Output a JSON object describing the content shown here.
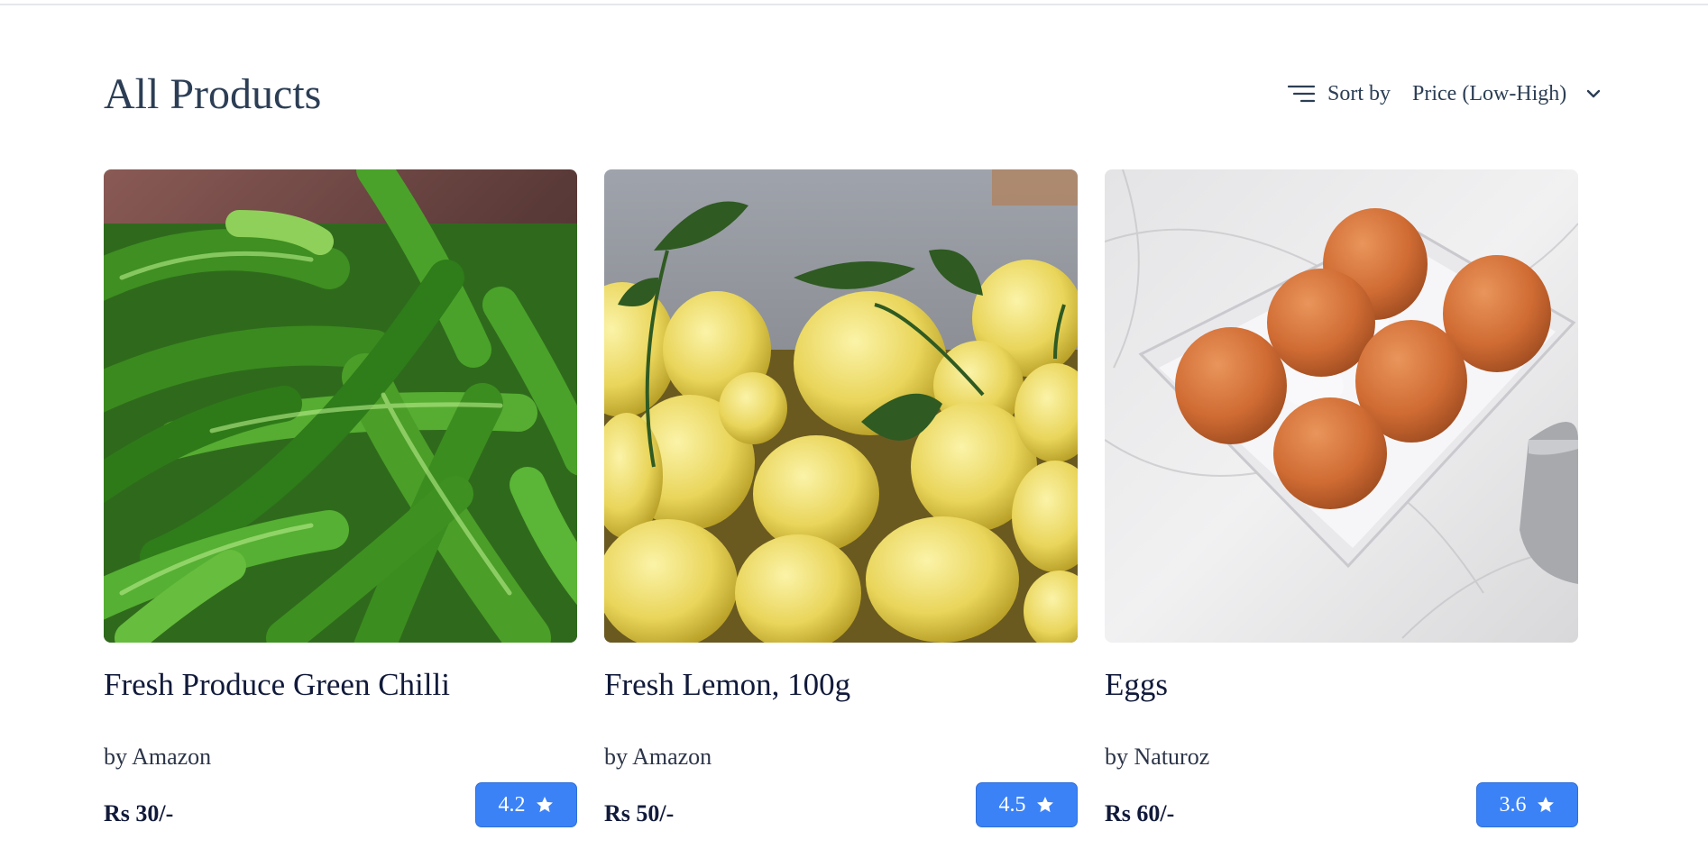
{
  "page": {
    "title": "All Products"
  },
  "sort": {
    "label": "Sort by",
    "value": "Price (Low-High)",
    "icon": "sort-lines-icon"
  },
  "products": [
    {
      "name": "Fresh Produce Green Chilli",
      "brand": "by Amazon",
      "price": "Rs 30/-",
      "rating": "4.2",
      "image": "green-chilli-photo"
    },
    {
      "name": "Fresh Lemon, 100g",
      "brand": "by Amazon",
      "price": "Rs 50/-",
      "rating": "4.5",
      "image": "lemons-photo"
    },
    {
      "name": "Eggs",
      "brand": "by Naturoz",
      "price": "Rs 60/-",
      "rating": "3.6",
      "image": "eggs-in-tray-photo"
    }
  ],
  "colors": {
    "accent": "#3b82f6",
    "heading": "#2c3e55",
    "text_dark": "#111a3a"
  }
}
